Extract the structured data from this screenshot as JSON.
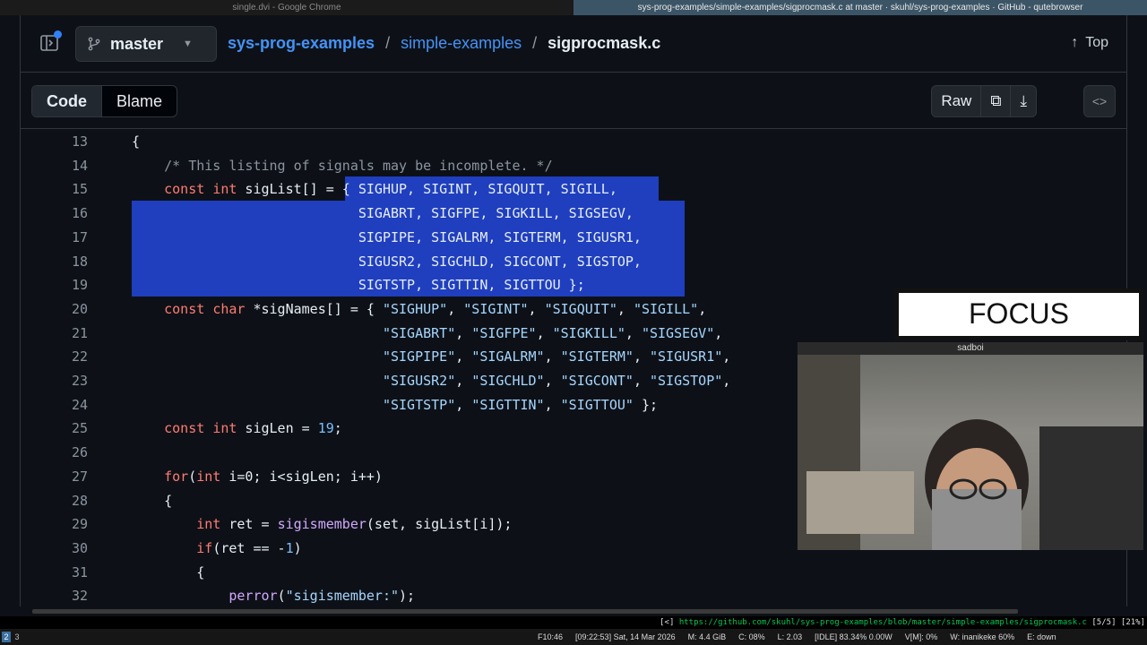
{
  "browser": {
    "tabs": [
      {
        "title": "single.dvi - Google Chrome",
        "active": false
      },
      {
        "title": "sys-prog-examples/simple-examples/sigprocmask.c at master · skuhl/sys-prog-examples · GitHub - qutebrowser",
        "active": true
      }
    ],
    "url": "https://github.com/skuhl/sys-prog-examples/blob/master/simple-examples/sigprocmask.c",
    "url_prefix": "[<]",
    "url_progress": "[5/5]",
    "url_scroll": "[21%]"
  },
  "header": {
    "branch": "master",
    "repo": "sys-prog-examples",
    "directory": "simple-examples",
    "separator": "/",
    "filename": "sigprocmask.c",
    "top_label": "Top",
    "top_arrow": "↑"
  },
  "toolbar": {
    "code_tab": "Code",
    "blame_tab": "Blame",
    "raw_label": "Raw",
    "copy_icon": "⧉",
    "download_icon": "⤓",
    "symbols_icon": "<>"
  },
  "code_lines": [
    {
      "n": "13",
      "t": "{"
    },
    {
      "n": "14",
      "t": "    /* This listing of signals may be incomplete. */"
    },
    {
      "n": "15",
      "t": "    const int sigList[] = { SIGHUP, SIGINT, SIGQUIT, SIGILL,"
    },
    {
      "n": "16",
      "t": "                            SIGABRT, SIGFPE, SIGKILL, SIGSEGV,"
    },
    {
      "n": "17",
      "t": "                            SIGPIPE, SIGALRM, SIGTERM, SIGUSR1,"
    },
    {
      "n": "18",
      "t": "                            SIGUSR2, SIGCHLD, SIGCONT, SIGSTOP,"
    },
    {
      "n": "19",
      "t": "                            SIGTSTP, SIGTTIN, SIGTTOU };"
    },
    {
      "n": "20",
      "t": "    const char *sigNames[] = { \"SIGHUP\", \"SIGINT\", \"SIGQUIT\", \"SIGILL\","
    },
    {
      "n": "21",
      "t": "                               \"SIGABRT\", \"SIGFPE\", \"SIGKILL\", \"SIGSEGV\","
    },
    {
      "n": "22",
      "t": "                               \"SIGPIPE\", \"SIGALRM\", \"SIGTERM\", \"SIGUSR1\","
    },
    {
      "n": "23",
      "t": "                               \"SIGUSR2\", \"SIGCHLD\", \"SIGCONT\", \"SIGSTOP\","
    },
    {
      "n": "24",
      "t": "                               \"SIGTSTP\", \"SIGTTIN\", \"SIGTTOU\" };"
    },
    {
      "n": "25",
      "t": "    const int sigLen = 19;"
    },
    {
      "n": "26",
      "t": ""
    },
    {
      "n": "27",
      "t": "    for(int i=0; i<sigLen; i++)"
    },
    {
      "n": "28",
      "t": "    {"
    },
    {
      "n": "29",
      "t": "        int ret = sigismember(set, sigList[i]);"
    },
    {
      "n": "30",
      "t": "        if(ret == -1)"
    },
    {
      "n": "31",
      "t": "        {"
    },
    {
      "n": "32",
      "t": "            perror(\"sigismember:\");"
    }
  ],
  "statusbar": {
    "workspaces": [
      "2",
      "3"
    ],
    "items": [
      "F10:46",
      "[09:22:53] Sat, 14 Mar 2026",
      "M: 4.4 GiB",
      "C: 08%",
      "L: 2.03",
      "[IDLE] 83.34% 0.00W",
      "V[M]: 0%",
      "W: inanikeke 60%",
      "E: down"
    ]
  },
  "overlay": {
    "focus_text": "FOCUS",
    "camera_title": "sadboi"
  },
  "colors": {
    "background": "#0d1117",
    "link": "#4493f8",
    "keyword": "#ff7b72",
    "selection": "#1f3fbf"
  }
}
